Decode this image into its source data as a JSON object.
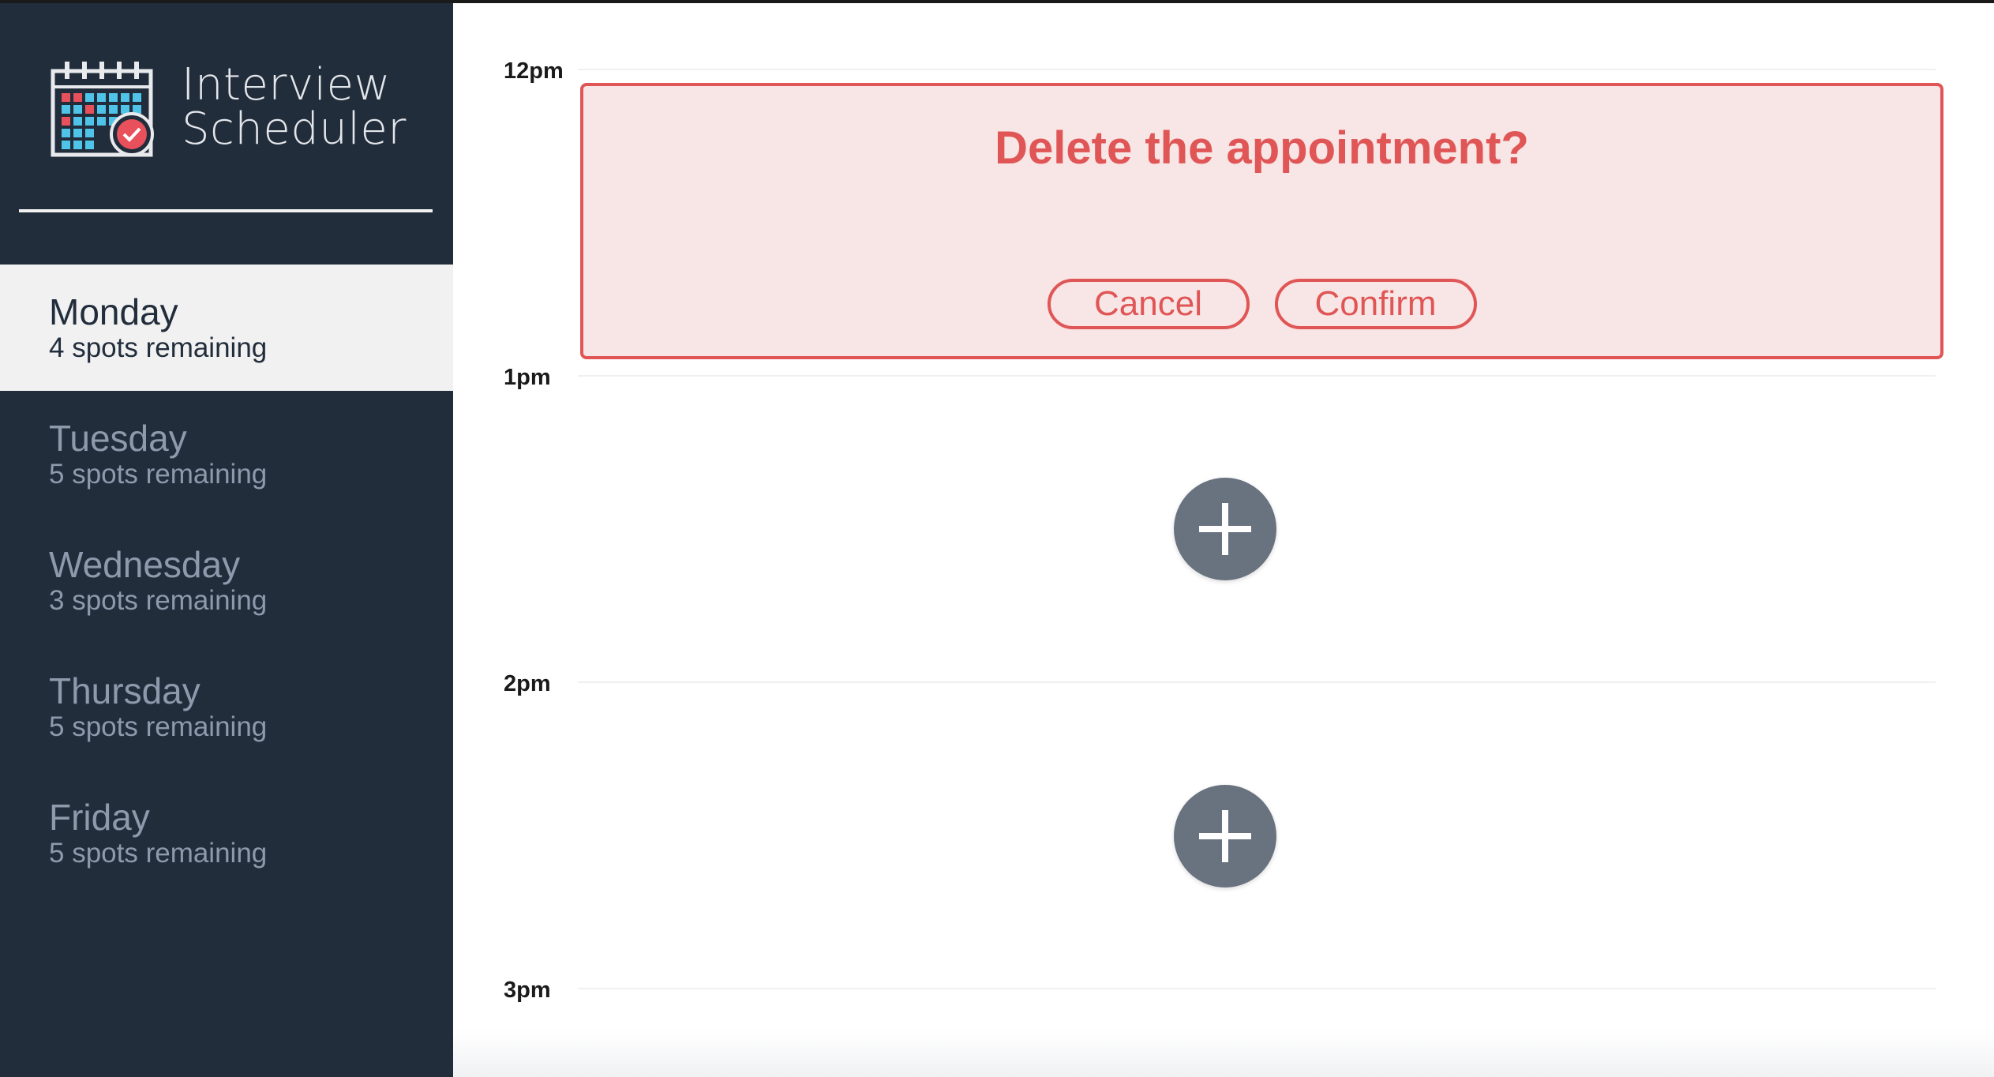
{
  "app": {
    "name_line1": "Interview",
    "name_line2": "Scheduler",
    "logo_icon": "calendar-check-icon"
  },
  "days": [
    {
      "name": "Monday",
      "spots": "4 spots remaining",
      "selected": true
    },
    {
      "name": "Tuesday",
      "spots": "5 spots remaining",
      "selected": false
    },
    {
      "name": "Wednesday",
      "spots": "3 spots remaining",
      "selected": false
    },
    {
      "name": "Thursday",
      "spots": "5 spots remaining",
      "selected": false
    },
    {
      "name": "Friday",
      "spots": "5 spots remaining",
      "selected": false
    }
  ],
  "schedule": {
    "times": [
      "12pm",
      "1pm",
      "2pm",
      "3pm"
    ],
    "confirm": {
      "message": "Delete the appointment?",
      "cancel_label": "Cancel",
      "confirm_label": "Confirm"
    },
    "add_icon": "plus-icon"
  },
  "colors": {
    "sidebar_bg": "#222d3c",
    "selected_day_bg": "#f1f1f1",
    "danger": "#e05656",
    "danger_bg": "#f8e5e5",
    "add_button": "#69727f"
  }
}
